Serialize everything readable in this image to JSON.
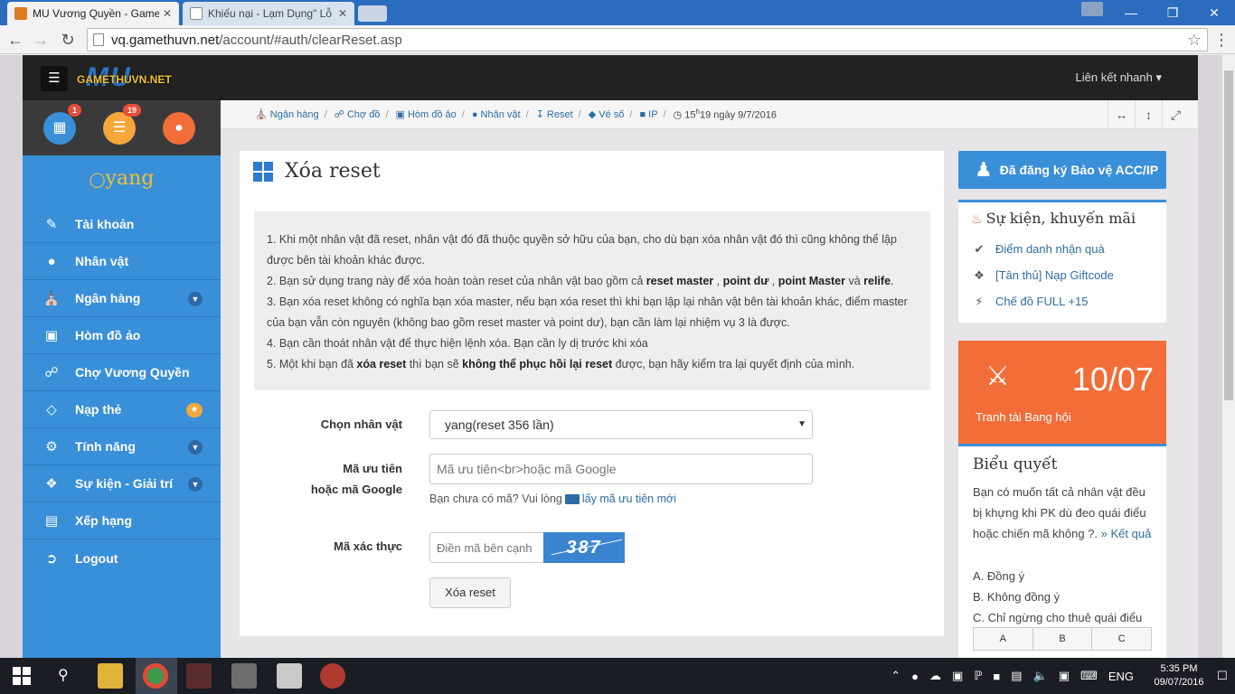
{
  "browser": {
    "tabs": [
      {
        "title": "MU Vương Quyền - Game",
        "close": "✕"
      },
      {
        "title": "Khiếu nại - Lạm Dụng\" Lỗ",
        "close": "✕"
      }
    ],
    "url_host": "vq.gamethuvn.net",
    "url_path": "/account/#auth/clearReset.asp"
  },
  "header": {
    "logo_mu": "MU",
    "logo_text": "GAMETHUVN.NET",
    "quick_link": "Liên kết nhanh"
  },
  "sidebar": {
    "badges": {
      "calendar": "1",
      "news": "19"
    },
    "username": "yang",
    "items": [
      {
        "label": "Tài khoản",
        "icon": "edit-icon"
      },
      {
        "label": "Nhân vật",
        "icon": "user-icon"
      },
      {
        "label": "Ngân hàng",
        "icon": "bank-icon"
      },
      {
        "label": "Hòm đồ ảo",
        "icon": "briefcase-icon"
      },
      {
        "label": "Chợ Vương Quyền",
        "icon": "cart-icon"
      },
      {
        "label": "Nạp thẻ",
        "icon": "diamond-icon"
      },
      {
        "label": "Tính năng",
        "icon": "cogs-icon"
      },
      {
        "label": "Sự kiện - Giải trí",
        "icon": "gift-icon"
      },
      {
        "label": "Xếp hạng",
        "icon": "chart-icon"
      },
      {
        "label": "Logout",
        "icon": "logout-icon"
      }
    ]
  },
  "breadcrumb": {
    "items": [
      "Ngân hàng",
      "Chợ đồ",
      "Hòm đồ ảo",
      "Nhân vật",
      "Reset",
      "Vé số",
      "IP"
    ],
    "time_prefix": "15",
    "time_sup": "h",
    "time_rest": "19 ngày 9/7/2016"
  },
  "main": {
    "title": "Xóa reset",
    "notice": {
      "l1": "1. Khi một nhân vật đã reset, nhân vật đó đã thuộc quyền sở hữu của bạn, cho dù bạn xóa nhân vật đó thì cũng không thể lập được bên tài khoản khác được.",
      "l2a": "2. Bạn sử dụng trang này để xóa hoàn toàn reset của nhân vật bao gồm cả ",
      "l2b": "reset master",
      "l2c": " , ",
      "l2d": "point dư",
      "l2e": " , ",
      "l2f": "point Master",
      "l2g": " và ",
      "l2h": "relife",
      "l2i": ".",
      "l3": "3. Bạn xóa reset không có nghĩa bạn xóa master, nếu bạn xóa reset thì khi bạn lập lại nhân vật bên tài khoản khác, điểm master của bạn vẫn còn nguyên (không bao gồm reset master và point dư), bạn cần làm lại nhiệm vụ 3 là được.",
      "l4": "4. Bạn cần thoát nhân vật để thực hiện lệnh xóa. Bạn cần ly dị trước khi xóa",
      "l5a": "5. Một khi bạn đã ",
      "l5b": "xóa reset",
      "l5c": " thì bạn sẽ ",
      "l5d": "không thể phục hồi lại reset",
      "l5e": " được, bạn hãy kiểm tra lại quyết định của mình."
    },
    "form": {
      "char_label": "Chọn nhân vật",
      "char_value": "yang(reset 356 lần)",
      "code_label1": "Mã ưu tiên",
      "code_label2": "hoặc mã Google",
      "code_placeholder": "Mã ưu tiên<br>hoặc mã Google",
      "hint_text": "Bạn chưa có mã? Vui lòng",
      "hint_link": "lấy mã ưu tiên mới",
      "captcha_label": "Mã xác thực",
      "captcha_placeholder": "Điền mã bên cạnh",
      "captcha_value": "387",
      "submit": "Xóa reset"
    }
  },
  "right": {
    "protect": "Đã đăng ký Bảo vệ ACC/IP",
    "events_title": "Sự kiện, khuyến mãi",
    "events": [
      {
        "label": "Điểm danh nhận quà",
        "icon": "check-circle-icon"
      },
      {
        "label": "[Tân thủ] Nạp Giftcode",
        "icon": "gift-icon"
      },
      {
        "label": "Chế đồ FULL +15",
        "icon": "plug-icon"
      }
    ],
    "guild_date": "10/07",
    "guild_label": "Tranh tài Bang hội",
    "poll_title": "Biểu quyết",
    "poll_question": "Bạn có muốn tất cả nhân vật đều bị khựng khi PK dù đeo quái điểu hoặc chiến mã không ?.",
    "poll_result": "» Kết quả",
    "poll_options": [
      "A. Đồng ý",
      "B. Không đồng ý",
      "C. Chỉ ngừng cho thuê quái điểu"
    ],
    "poll_buttons": [
      "A",
      "B",
      "C"
    ]
  },
  "taskbar": {
    "lang": "ENG",
    "time": "5:35 PM",
    "date": "09/07/2016"
  },
  "colors": {
    "sidebar": "#3a8fd9",
    "guild": "#f26d38",
    "header": "#222222"
  }
}
